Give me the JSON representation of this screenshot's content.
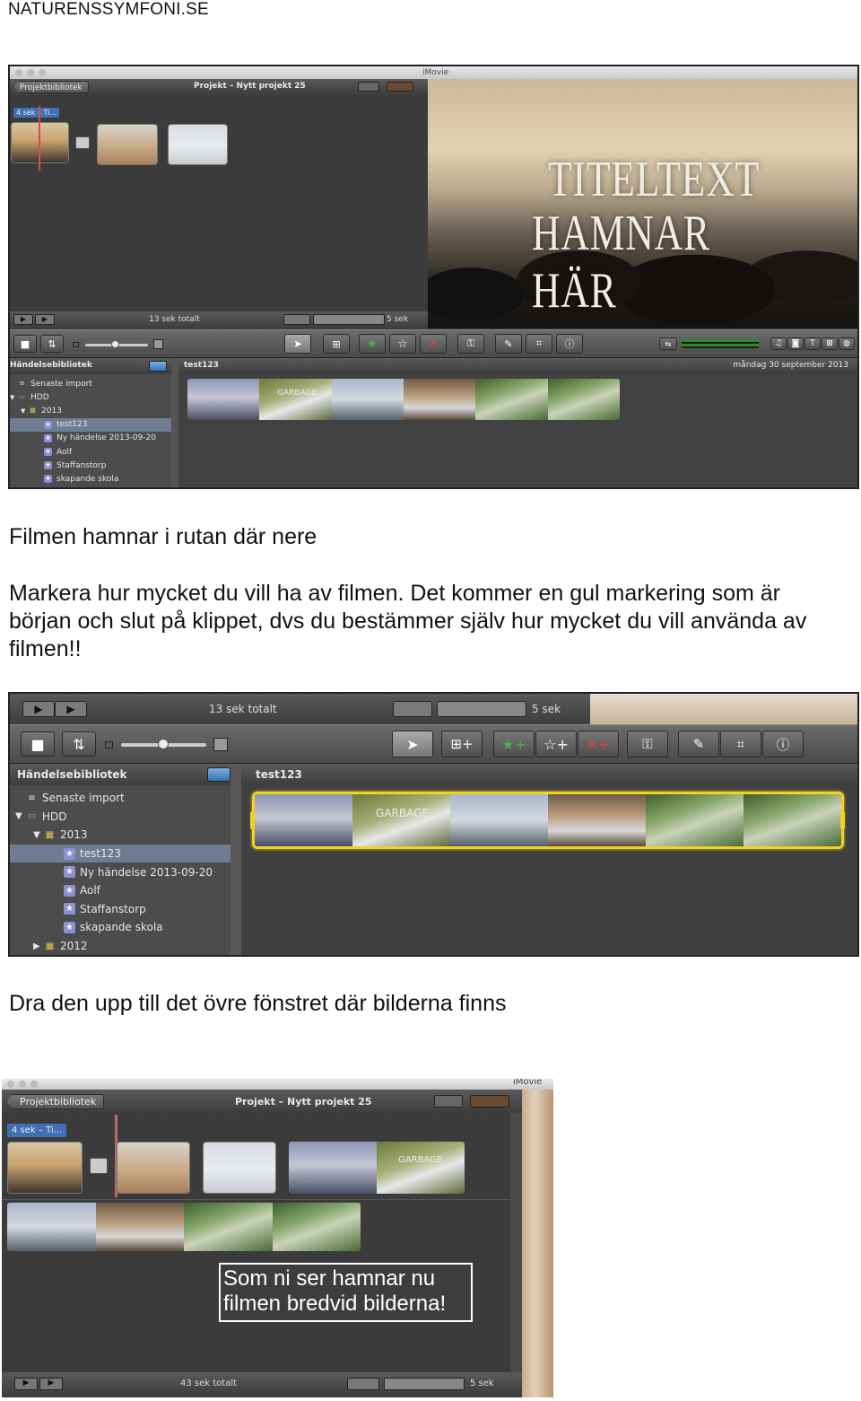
{
  "site_title": "NATURENSSYMFONI.SE",
  "paragraphs": {
    "p1": "Filmen hamnar i rutan där nere",
    "p2_line1": "Markera hur mycket du vill ha av filmen. Det kommer en gul markering som är",
    "p2_line2": "början och slut på klippet, dvs du bestämmer själv hur mycket du vill använda av",
    "p2_line3": "filmen!!",
    "p3": "Dra den upp till det övre fönstret där bilderna finns"
  },
  "shot1": {
    "window_title": "iMovie",
    "project_library_button": "Projektbibliotek",
    "project_name": "Projekt – Nytt projekt 25",
    "clip_tag": "4 sek – Ti...",
    "total_label": "13 sek totalt",
    "duration_label": "5 sek",
    "viewer_title_line1": "TITELTEXT",
    "viewer_title_line2": "HAMNAR HÄR",
    "event_library_label": "Händelsebibliotek",
    "event_name": "test123",
    "event_date": "måndag 30 september 2013",
    "clip_overlay": "GARBAGE",
    "tree": [
      {
        "label": "Senaste import",
        "icon": "recent-icon"
      },
      {
        "label": "HDD",
        "icon": "drive-icon"
      },
      {
        "label": "2013",
        "icon": "calendar-icon"
      },
      {
        "label": "test123",
        "icon": "star-icon"
      },
      {
        "label": "Ny händelse 2013-09-20",
        "icon": "star-icon"
      },
      {
        "label": "Aolf",
        "icon": "star-icon"
      },
      {
        "label": "Staffanstorp",
        "icon": "star-icon"
      },
      {
        "label": "skapande skola",
        "icon": "star-icon"
      }
    ]
  },
  "shot2": {
    "total_label": "13 sek totalt",
    "duration_label": "5 sek",
    "event_library_label": "Händelsebibliotek",
    "event_name": "test123",
    "clip_overlay": "GARBAGE",
    "tree": [
      {
        "label": "Senaste import",
        "icon": "recent-icon"
      },
      {
        "label": "HDD",
        "icon": "drive-icon"
      },
      {
        "label": "2013",
        "icon": "calendar-icon"
      },
      {
        "label": "test123",
        "icon": "star-icon"
      },
      {
        "label": "Ny händelse 2013-09-20",
        "icon": "star-icon"
      },
      {
        "label": "Aolf",
        "icon": "star-icon"
      },
      {
        "label": "Staffanstorp",
        "icon": "star-icon"
      },
      {
        "label": "skapande skola",
        "icon": "star-icon"
      },
      {
        "label": "2012",
        "icon": "calendar-icon"
      }
    ]
  },
  "shot3": {
    "window_title": "iMovie",
    "project_library_button": "Projektbibliotek",
    "project_name": "Projekt – Nytt projekt 25",
    "clip_tag": "4 sek – Ti...",
    "clip_overlay": "GARBAGE",
    "callout_line1": "Som ni ser hamnar nu",
    "callout_line2": "filmen bredvid bilderna!",
    "total_label": "43 sek totalt",
    "duration_label": "5 sek"
  },
  "colors": {
    "selection_yellow": "#f2d21b",
    "sidebar_selected": "#6f7d93",
    "star_event": "#8a8fd6"
  }
}
